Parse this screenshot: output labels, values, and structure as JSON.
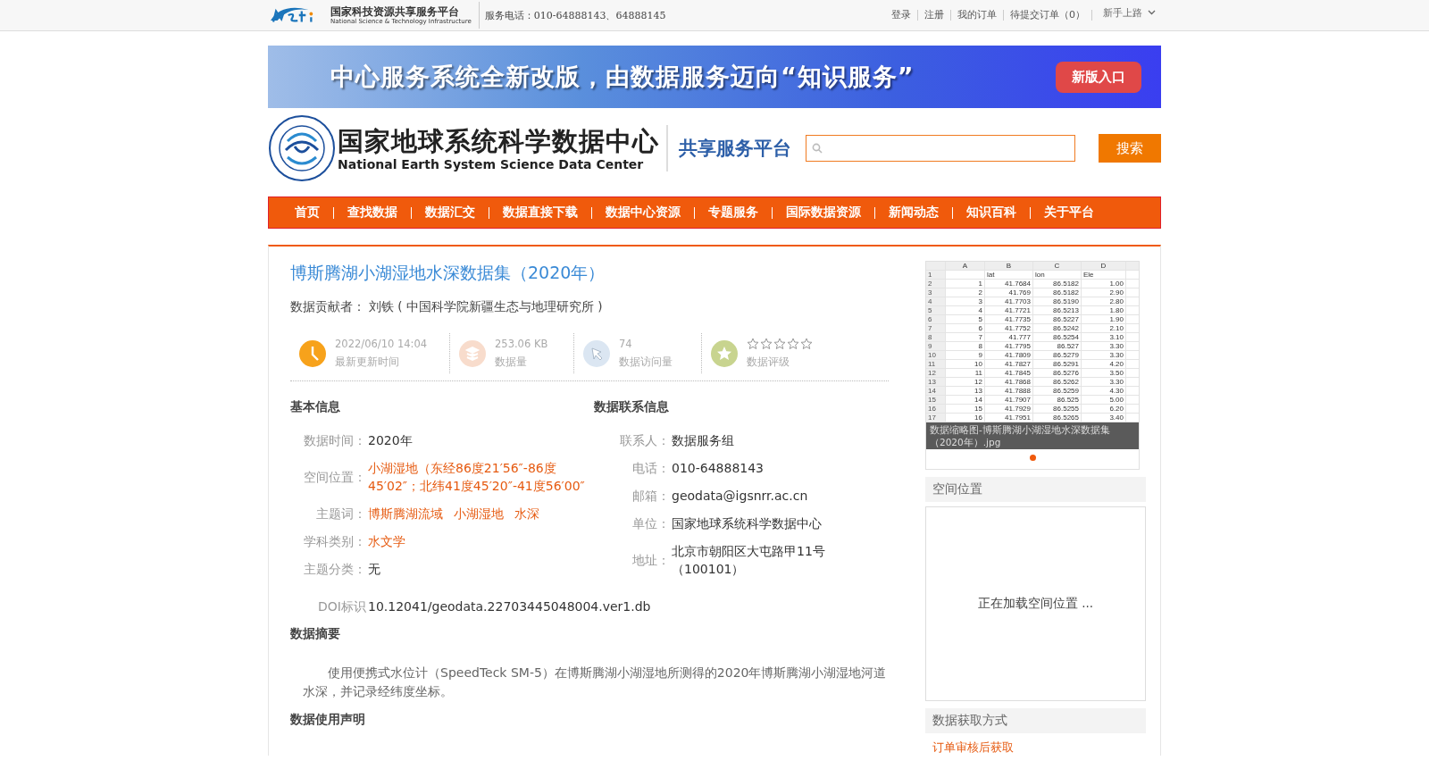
{
  "topbar": {
    "logo_title": "国家科技资源共享服务平台",
    "logo_subtitle": "National Science & Technology Infrastructure",
    "phone": "服务电话：010-64888143、64888145",
    "links": [
      "登录",
      "注册",
      "我的订单",
      "待提交订单（0）"
    ],
    "guide": "新手上路"
  },
  "banner": {
    "text": "中心服务系统全新改版，由数据服务迈向“知识服务”",
    "button": "新版入口"
  },
  "header": {
    "logo_title": "国家地球系统科学数据中心",
    "logo_subtitle": "National Earth System Science Data Center",
    "platform": "共享服务平台",
    "search_button": "搜索"
  },
  "nav": [
    {
      "label": "首页"
    },
    {
      "label": "查找数据"
    },
    {
      "label": "数据汇交"
    },
    {
      "label": "数据直接下载"
    },
    {
      "label": "数据中心资源"
    },
    {
      "label": "专题服务"
    },
    {
      "label": "国际数据资源"
    },
    {
      "label": "新闻动态"
    },
    {
      "label": "知识百科"
    },
    {
      "label": "关于平台"
    }
  ],
  "dataset": {
    "title": "博斯腾湖小湖湿地水深数据集（2020年）",
    "contributor_label": "数据贡献者：",
    "contributor": "刘铁 ( 中国科学院新疆生态与地理研究所 )",
    "stats": [
      {
        "kind": "time",
        "value": "2022/06/10 14:04",
        "label": "最新更新时间"
      },
      {
        "kind": "size",
        "value": "253.06 KB",
        "label": "数据量"
      },
      {
        "kind": "visits",
        "value": "74",
        "label": "数据访问量"
      },
      {
        "kind": "rating",
        "stars": 0,
        "label": "数据评级"
      }
    ]
  },
  "basic_info": {
    "heading": "基本信息",
    "fields": [
      {
        "label": "数据时间：",
        "kind": "plain",
        "value": "2020年"
      },
      {
        "label": "空间位置：",
        "kind": "link",
        "value": "小湖湿地（东经86度21′56″-86度45′02″；北纬41度45′20″-41度56′00″"
      },
      {
        "label": "主题词：",
        "kind": "tags",
        "values": [
          "博斯腾湖流域",
          "小湖湿地",
          "水深"
        ]
      },
      {
        "label": "学科类别：",
        "kind": "link",
        "value": "水文学"
      },
      {
        "label": "主题分类：",
        "kind": "plain",
        "value": "无"
      }
    ]
  },
  "contact_info": {
    "heading": "数据联系信息",
    "fields": [
      {
        "label": "联系人：",
        "value": "数据服务组"
      },
      {
        "label": "电话：",
        "value": "010-64888143"
      },
      {
        "label": "邮箱：",
        "value": "geodata@igsnrr.ac.cn"
      },
      {
        "label": "单位：",
        "value": "国家地球系统科学数据中心"
      },
      {
        "label": "地址：",
        "value": "北京市朝阳区大屯路甲11号（100101）"
      }
    ]
  },
  "doi": {
    "label": "DOI标识",
    "value": "10.12041/geodata.22703445048004.ver1.db"
  },
  "abstract": {
    "heading": "数据摘要",
    "text": "使用便携式水位计（SpeedTeck SM-5）在博斯腾湖小湖湿地所测得的2020年博斯腾湖小湖湿地河道水深，并记录经纬度坐标。"
  },
  "usage": {
    "heading": "数据使用声明"
  },
  "sidebar": {
    "thumbnail": {
      "columns": [
        "",
        "A",
        "B",
        "C",
        "D"
      ],
      "rows": [
        [
          "1",
          "",
          "lat",
          "lon",
          "Ele"
        ],
        [
          "2",
          "1",
          "41.7684",
          "86.5182",
          "1.00"
        ],
        [
          "3",
          "2",
          "41.769",
          "86.5182",
          "2.90"
        ],
        [
          "4",
          "3",
          "41.7703",
          "86.5190",
          "2.80"
        ],
        [
          "5",
          "4",
          "41.7721",
          "86.5213",
          "1.80"
        ],
        [
          "6",
          "5",
          "41.7735",
          "86.5227",
          "1.90"
        ],
        [
          "7",
          "6",
          "41.7752",
          "86.5242",
          "2.10"
        ],
        [
          "8",
          "7",
          "41.777",
          "86.5254",
          "3.10"
        ],
        [
          "9",
          "8",
          "41.7795",
          "86.527",
          "3.30"
        ],
        [
          "10",
          "9",
          "41.7809",
          "86.5279",
          "3.30"
        ],
        [
          "11",
          "10",
          "41.7827",
          "86.5291",
          "4.20"
        ],
        [
          "12",
          "11",
          "41.7845",
          "86.5276",
          "3.50"
        ],
        [
          "13",
          "12",
          "41.7868",
          "86.5262",
          "3.30"
        ],
        [
          "14",
          "13",
          "41.7888",
          "86.5259",
          "4.30"
        ],
        [
          "15",
          "14",
          "41.7907",
          "86.525",
          "5.00"
        ],
        [
          "16",
          "15",
          "41.7929",
          "86.5255",
          "6.20"
        ],
        [
          "17",
          "16",
          "41.7951",
          "86.5265",
          "3.40"
        ]
      ],
      "caption": "数据缩略图-博斯腾湖小湖湿地水深数据集（2020年）.jpg"
    },
    "dots": [
      {
        "selected": true
      }
    ],
    "spatial": {
      "heading": "空间位置",
      "loading": "正在加载空间位置 ..."
    },
    "access": {
      "heading": "数据获取方式",
      "link": "订单审核后获取"
    }
  }
}
